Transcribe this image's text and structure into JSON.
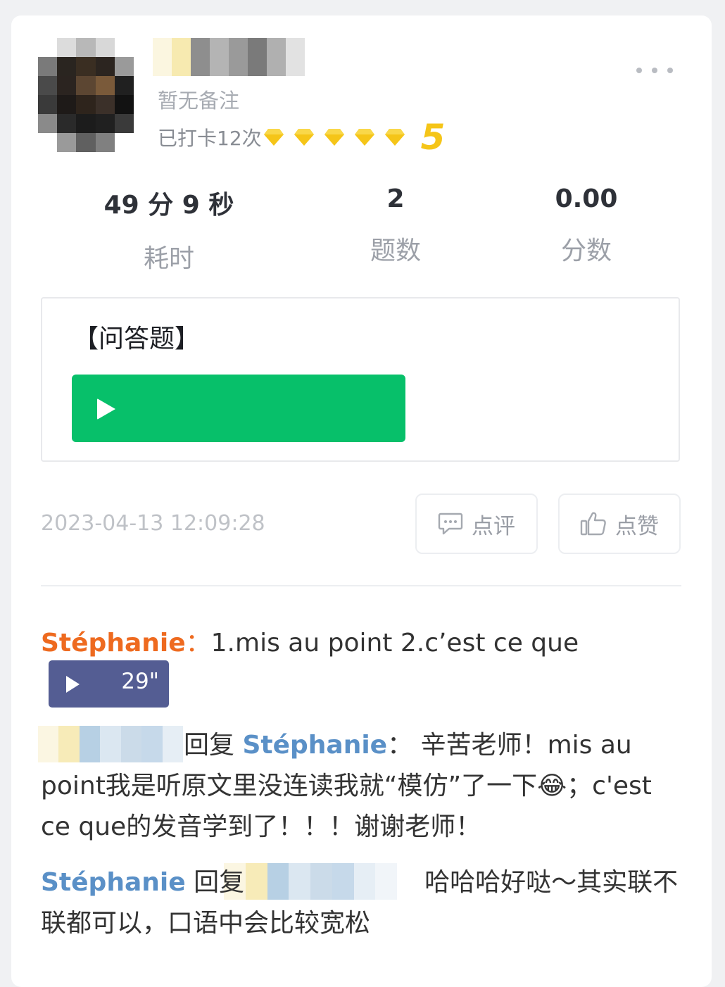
{
  "post": {
    "remark": "暂无备注",
    "checkin_text": "已打卡12次",
    "level": "5",
    "gem_count": 5,
    "gem_color": "#f5c518",
    "more_icon": "more-dots-icon"
  },
  "stats": [
    {
      "value": "49 分 9 秒",
      "label": "耗时"
    },
    {
      "value": "2",
      "label": "题数"
    },
    {
      "value": "0.00",
      "label": "分数"
    }
  ],
  "question": {
    "title": "【问答题】",
    "audio_icon": "play-icon",
    "audio_color": "#07c06a"
  },
  "footer": {
    "timestamp": "2023-04-13 12:09:28",
    "comment_label": "点评",
    "like_label": "点赞"
  },
  "comments": [
    {
      "author": "Stéphanie",
      "separator": "：",
      "text": "1.mis au point 2.c’est ce que",
      "voice_duration": "29\""
    },
    {
      "reply_word": "回复",
      "target": "Stéphanie",
      "separator": "：",
      "text": "辛苦老师！mis au point我是听原文里没连读我就“模仿”了一下😂；c'est ce que的发音学到了！！！谢谢老师！"
    },
    {
      "author": "Stéphanie",
      "reply_word": "回复",
      "text": "哈哈哈好哒～其实联不联都可以，口语中会比较宽松"
    }
  ],
  "colors": {
    "author_orange": "#ee6a1f",
    "author_blue": "#5a90c7",
    "voice_bg": "#545d93"
  }
}
